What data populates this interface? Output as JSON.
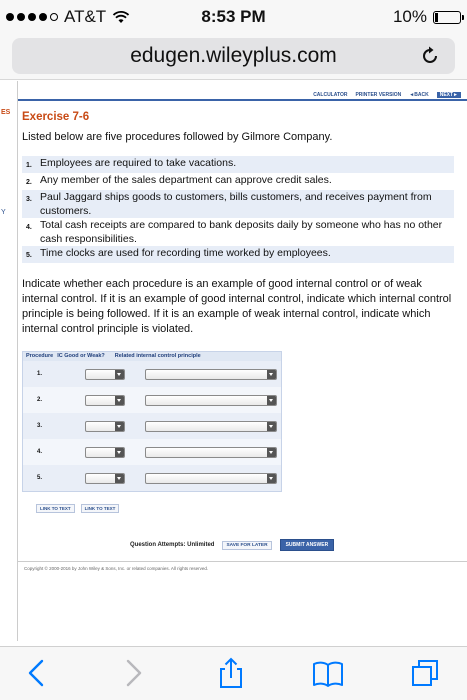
{
  "status_bar": {
    "carrier": "AT&T",
    "time": "8:53 PM",
    "battery": "10%"
  },
  "browser": {
    "url": "edugen.wileyplus.com"
  },
  "top_nav": {
    "calculator": "CALCULATOR",
    "printer_version": "PRINTER VERSION",
    "back": "◄BACK",
    "next": "NEXT►"
  },
  "sidebar": {
    "letter_1": "ES",
    "letter_2": "Y"
  },
  "exercise": {
    "title": "Exercise 7-6",
    "intro": "Listed below are five procedures followed by Gilmore Company.",
    "procedures": [
      {
        "num": "1.",
        "text": "Employees are required to take vacations."
      },
      {
        "num": "2.",
        "text": "Any member of the sales department can approve credit sales."
      },
      {
        "num": "3.",
        "text": "Paul Jaggard ships goods to customers, bills customers, and receives payment from customers."
      },
      {
        "num": "4.",
        "text": "Total cash receipts are compared to bank deposits daily by someone who has no other cash responsibilities."
      },
      {
        "num": "5.",
        "text": "Time clocks are used for recording time worked by employees."
      }
    ],
    "instructions": "Indicate whether each procedure is an example of good internal control or of weak internal control. If it is an example of good internal control, indicate which internal control principle is being followed. If it is an example of weak internal control, indicate which internal control principle is violated."
  },
  "answer_table": {
    "col_procedure": "Procedure",
    "col_ic": "IC Good or Weak?",
    "col_principle": "Related internal control principle",
    "rows": [
      "1.",
      "2.",
      "3.",
      "4.",
      "5."
    ]
  },
  "links": {
    "link1": "LINK TO TEXT",
    "link2": "LINK TO TEXT"
  },
  "actions": {
    "attempts": "Question Attempts: Unlimited",
    "save": "SAVE FOR LATER",
    "submit": "SUBMIT ANSWER"
  },
  "footer": {
    "copyright": "Copyright © 2000-2016 by John Wiley & Sons, Inc. or related companies. All rights reserved."
  },
  "colors": {
    "accent": "#3a63a8",
    "title_orange": "#c84a15",
    "ios_blue": "#007aff"
  },
  "toolbar_icons": [
    "back-arrow-icon",
    "forward-arrow-icon",
    "share-icon",
    "bookmarks-icon",
    "tabs-icon"
  ]
}
